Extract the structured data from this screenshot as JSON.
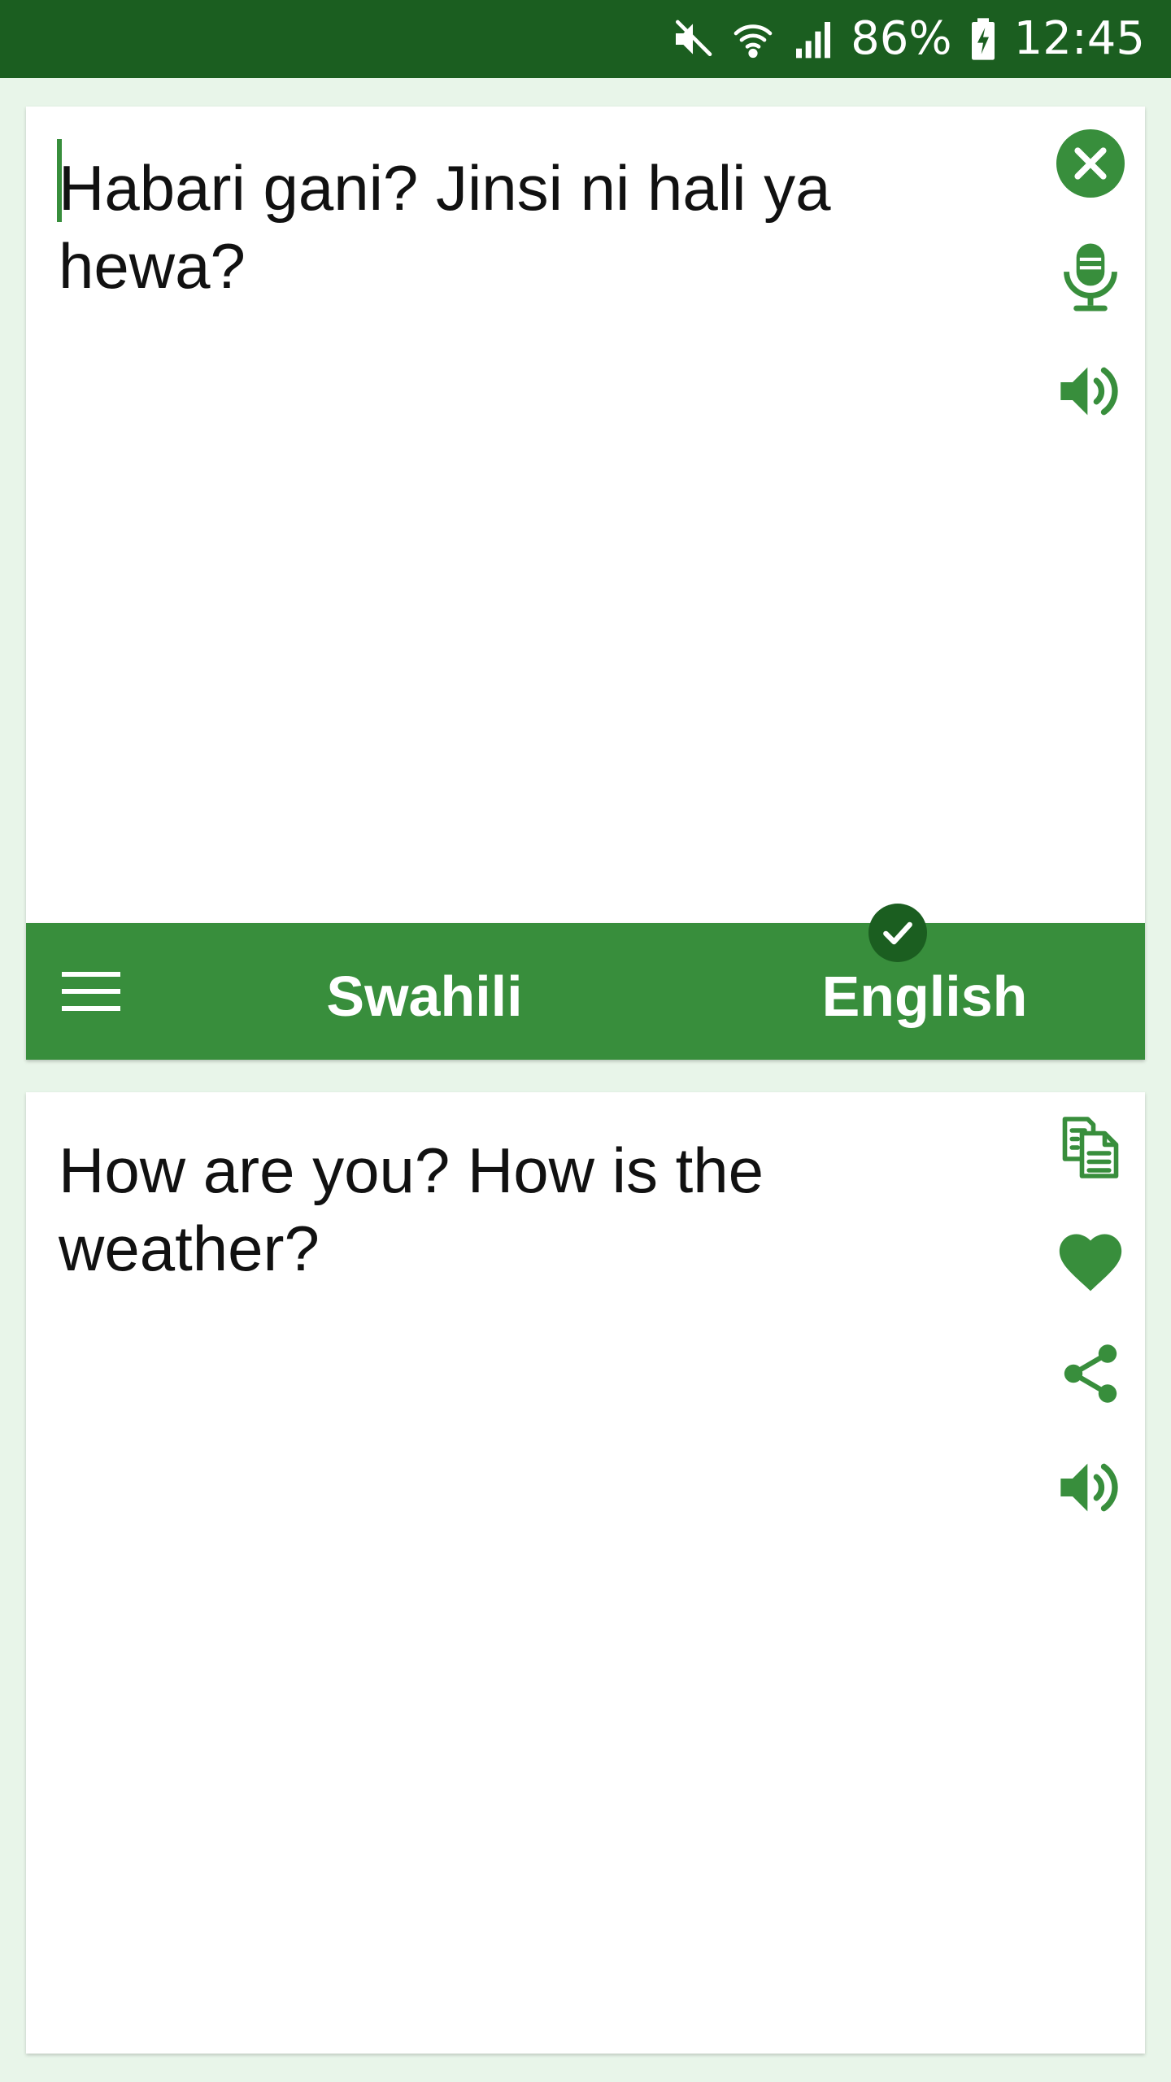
{
  "status_bar": {
    "battery": "86%",
    "time": "12:45",
    "icons": [
      "mute-icon",
      "wifi-icon",
      "signal-icon",
      "battery-charging-icon"
    ]
  },
  "source": {
    "text": "Habari gani? Jinsi ni hali ya hewa?",
    "icons": [
      "clear-icon",
      "microphone-icon",
      "speaker-icon"
    ]
  },
  "language_bar": {
    "source_language": "Swahili",
    "target_language": "English",
    "icons": [
      "menu-icon",
      "check-icon"
    ]
  },
  "target": {
    "text": "How are you? How is the weather?",
    "icons": [
      "copy-icon",
      "favorite-heart-icon",
      "share-icon",
      "speaker-icon"
    ]
  },
  "colors": {
    "status_bar": "#1b5e20",
    "accent": "#388e3c",
    "background": "#e8f5e9",
    "card": "#ffffff"
  }
}
